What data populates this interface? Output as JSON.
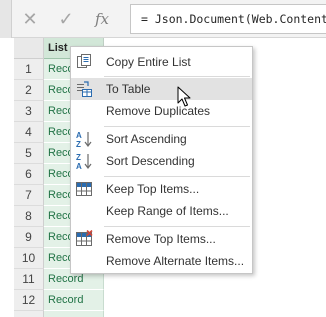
{
  "formula_bar": {
    "cancel_glyph": "✕",
    "enter_glyph": "✓",
    "fx_label": "fx",
    "formula": "= Json.Document(Web.Contents"
  },
  "grid": {
    "column_header": "List",
    "rows": [
      {
        "num": "1",
        "value": "Reco"
      },
      {
        "num": "2",
        "value": "Reco"
      },
      {
        "num": "3",
        "value": "Reco"
      },
      {
        "num": "4",
        "value": "Reco"
      },
      {
        "num": "5",
        "value": "Reco"
      },
      {
        "num": "6",
        "value": "Reco"
      },
      {
        "num": "7",
        "value": "Reco"
      },
      {
        "num": "8",
        "value": "Reco"
      },
      {
        "num": "9",
        "value": "Reco"
      },
      {
        "num": "10",
        "value": "Reco"
      },
      {
        "num": "11",
        "value": "Record"
      },
      {
        "num": "12",
        "value": "Record"
      }
    ]
  },
  "context_menu": {
    "items": [
      {
        "label": "Copy Entire List",
        "icon": "copy-list-icon"
      },
      {
        "label": "To Table",
        "icon": "to-table-icon",
        "hovered": true
      },
      {
        "label": "Remove Duplicates",
        "icon": ""
      },
      {
        "label": "Sort Ascending",
        "icon": "sort-ascending-icon"
      },
      {
        "label": "Sort Descending",
        "icon": "sort-descending-icon"
      },
      {
        "label": "Keep Top Items...",
        "icon": "keep-top-items-icon"
      },
      {
        "label": "Keep Range of Items...",
        "icon": ""
      },
      {
        "label": "Remove Top Items...",
        "icon": "remove-top-items-icon"
      },
      {
        "label": "Remove Alternate Items...",
        "icon": ""
      }
    ]
  },
  "colors": {
    "column_header_bg": "#d2e7d8",
    "cell_bg": "#e3f1e7",
    "cell_text": "#217346",
    "menu_hover": "#e2e2e2",
    "icon_blue": "#2b6cb0",
    "icon_red": "#d04437"
  }
}
